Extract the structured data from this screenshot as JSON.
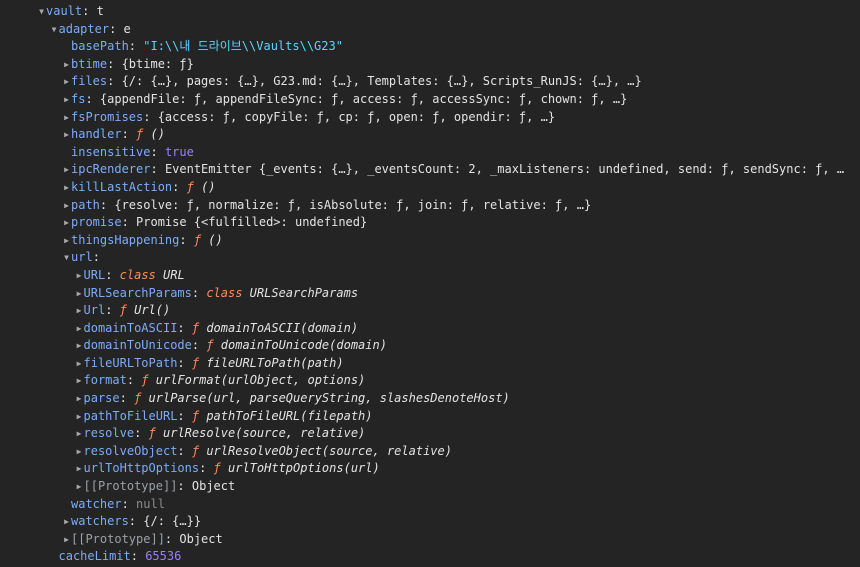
{
  "panel": {
    "colors": {
      "background": "#242424",
      "key": "#7cacf8",
      "string": "#5cd5fb",
      "number": "#9980ff",
      "function": "#ff8c5a",
      "null": "#8b8b8b"
    },
    "rows": [
      {
        "depth": 0,
        "toggle": "expanded",
        "key": "vault",
        "preview": "t",
        "type": "obj"
      },
      {
        "depth": 1,
        "toggle": "expanded",
        "key": "adapter",
        "preview": "e",
        "type": "obj"
      },
      {
        "depth": 2,
        "toggle": "none",
        "key": "basePath",
        "preview": "\"I:\\\\내 드라이브\\\\Vaults\\\\G23\"",
        "type": "string"
      },
      {
        "depth": 2,
        "toggle": "collapsed",
        "key": "btime",
        "preview": "{btime: ƒ}",
        "type": "obj"
      },
      {
        "depth": 2,
        "toggle": "collapsed",
        "key": "files",
        "preview": "{/: {…}, pages: {…}, G23.md: {…}, Templates: {…}, Scripts_RunJS: {…}, …}",
        "type": "obj"
      },
      {
        "depth": 2,
        "toggle": "collapsed",
        "key": "fs",
        "preview": "{appendFile: ƒ, appendFileSync: ƒ, access: ƒ, accessSync: ƒ, chown: ƒ, …}",
        "type": "obj"
      },
      {
        "depth": 2,
        "toggle": "collapsed",
        "key": "fsPromises",
        "preview": "{access: ƒ, copyFile: ƒ, cp: ƒ, open: ƒ, opendir: ƒ, …}",
        "type": "obj"
      },
      {
        "depth": 2,
        "toggle": "collapsed",
        "key": "handler",
        "preview_fn": "ƒ",
        "preview_sig": " ()",
        "type": "fn"
      },
      {
        "depth": 2,
        "toggle": "none",
        "key": "insensitive",
        "preview": "true",
        "type": "bool"
      },
      {
        "depth": 2,
        "toggle": "collapsed",
        "key": "ipcRenderer",
        "preview": "EventEmitter {_events: {…}, _eventsCount: 2, _maxListeners: undefined, send: ƒ, sendSync: ƒ, …",
        "type": "obj"
      },
      {
        "depth": 2,
        "toggle": "collapsed",
        "key": "killLastAction",
        "preview_fn": "ƒ",
        "preview_sig": " ()",
        "type": "fn"
      },
      {
        "depth": 2,
        "toggle": "collapsed",
        "key": "path",
        "preview": "{resolve: ƒ, normalize: ƒ, isAbsolute: ƒ, join: ƒ, relative: ƒ, …}",
        "type": "obj"
      },
      {
        "depth": 2,
        "toggle": "collapsed",
        "key": "promise",
        "preview": "Promise {<fulfilled>: undefined}",
        "type": "obj"
      },
      {
        "depth": 2,
        "toggle": "collapsed",
        "key": "thingsHappening",
        "preview_fn": "ƒ",
        "preview_sig": " ()",
        "type": "fn"
      },
      {
        "depth": 2,
        "toggle": "expanded",
        "key": "url",
        "preview": "",
        "type": "obj"
      },
      {
        "depth": 3,
        "toggle": "collapsed",
        "key": "URL",
        "preview_fn": "class",
        "preview_sig": " URL",
        "type": "class"
      },
      {
        "depth": 3,
        "toggle": "collapsed",
        "key": "URLSearchParams",
        "preview_fn": "class",
        "preview_sig": " URLSearchParams",
        "type": "class"
      },
      {
        "depth": 3,
        "toggle": "collapsed",
        "key": "Url",
        "preview_fn": "ƒ",
        "preview_sig": " Url()",
        "type": "fn"
      },
      {
        "depth": 3,
        "toggle": "collapsed",
        "key": "domainToASCII",
        "preview_fn": "ƒ",
        "preview_sig": " domainToASCII(domain)",
        "type": "fn"
      },
      {
        "depth": 3,
        "toggle": "collapsed",
        "key": "domainToUnicode",
        "preview_fn": "ƒ",
        "preview_sig": " domainToUnicode(domain)",
        "type": "fn"
      },
      {
        "depth": 3,
        "toggle": "collapsed",
        "key": "fileURLToPath",
        "preview_fn": "ƒ",
        "preview_sig": " fileURLToPath(path)",
        "type": "fn"
      },
      {
        "depth": 3,
        "toggle": "collapsed",
        "key": "format",
        "preview_fn": "ƒ",
        "preview_sig": " urlFormat(urlObject, options)",
        "type": "fn"
      },
      {
        "depth": 3,
        "toggle": "collapsed",
        "key": "parse",
        "preview_fn": "ƒ",
        "preview_sig": " urlParse(url, parseQueryString, slashesDenoteHost)",
        "type": "fn"
      },
      {
        "depth": 3,
        "toggle": "collapsed",
        "key": "pathToFileURL",
        "preview_fn": "ƒ",
        "preview_sig": " pathToFileURL(filepath)",
        "type": "fn"
      },
      {
        "depth": 3,
        "toggle": "collapsed",
        "key": "resolve",
        "preview_fn": "ƒ",
        "preview_sig": " urlResolve(source, relative)",
        "type": "fn"
      },
      {
        "depth": 3,
        "toggle": "collapsed",
        "key": "resolveObject",
        "preview_fn": "ƒ",
        "preview_sig": " urlResolveObject(source, relative)",
        "type": "fn"
      },
      {
        "depth": 3,
        "toggle": "collapsed",
        "key": "urlToHttpOptions",
        "preview_fn": "ƒ",
        "preview_sig": " urlToHttpOptions(url)",
        "type": "fn"
      },
      {
        "depth": 3,
        "toggle": "collapsed",
        "key": "[[Prototype]]",
        "preview": "Object",
        "type": "obj",
        "nonenum": true
      },
      {
        "depth": 2,
        "toggle": "none",
        "key": "watcher",
        "preview": "null",
        "type": "null"
      },
      {
        "depth": 2,
        "toggle": "collapsed",
        "key": "watchers",
        "preview": "{/: {…}}",
        "type": "obj"
      },
      {
        "depth": 2,
        "toggle": "collapsed",
        "key": "[[Prototype]]",
        "preview": "Object",
        "type": "obj",
        "nonenum": true
      },
      {
        "depth": 1,
        "toggle": "none",
        "key": "cacheLimit",
        "preview": "65536",
        "type": "number"
      }
    ]
  }
}
